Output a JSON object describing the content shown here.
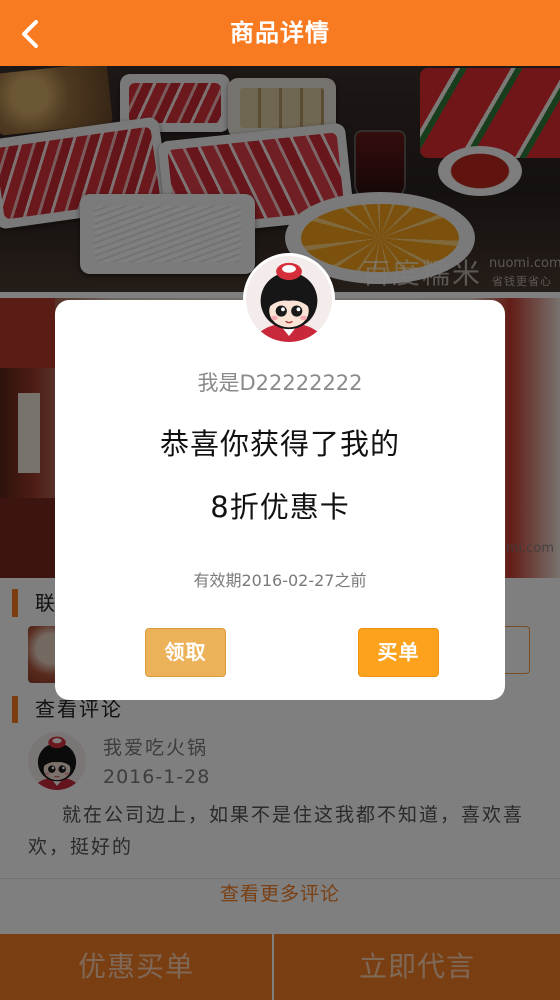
{
  "header": {
    "title": "商品详情",
    "back_icon": "chevron-left-icon"
  },
  "photos": {
    "watermark_brand": "百度糯米",
    "watermark_domain": "nuomi.com",
    "watermark_slogan": "省钱更省心"
  },
  "sections": {
    "contact_title": "联",
    "reviews_title": "查看评论"
  },
  "review": {
    "avatar_icon": "mascot-avatar-icon",
    "user": "我爱吃火锅",
    "date": "2016-1-28",
    "text": "就在公司边上，如果不是住这我都不知道，喜欢喜欢，挺好的"
  },
  "more_reviews": "查看更多评论",
  "bottom_bar": {
    "left_label": "优惠买单",
    "right_label": "立即代言"
  },
  "modal": {
    "avatar_icon": "mascot-avatar-icon",
    "greeting": "我是D22222222",
    "line1": "恭喜你获得了我的",
    "line2": "8折优惠卡",
    "validity": "有效期2016-02-27之前",
    "claim_button": "领取",
    "pay_button": "买单"
  },
  "colors": {
    "brand_orange": "#f87b22",
    "claim_button": "#ecb25a",
    "pay_button": "#fca21d",
    "overlay": "rgba(0,0,0,0.5)"
  }
}
